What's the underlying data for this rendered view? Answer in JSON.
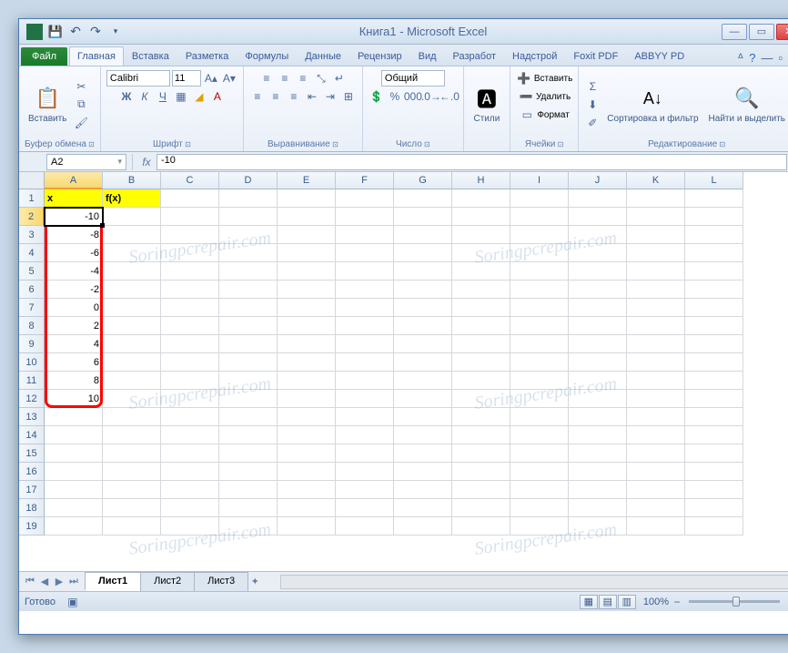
{
  "title": "Книга1  -  Microsoft Excel",
  "file_tab": "Файл",
  "tabs": [
    "Главная",
    "Вставка",
    "Разметка",
    "Формулы",
    "Данные",
    "Рецензир",
    "Вид",
    "Разработ",
    "Надстрой",
    "Foxit PDF",
    "ABBYY PD"
  ],
  "active_tab": 0,
  "ribbon": {
    "paste": "Вставить",
    "clipboard": "Буфер обмена",
    "font_name": "Calibri",
    "font_size": "11",
    "font": "Шрифт",
    "alignment": "Выравнивание",
    "number_format": "Общий",
    "number": "Число",
    "styles": "Стили",
    "insert": "Вставить",
    "delete": "Удалить",
    "format": "Формат",
    "cells": "Ячейки",
    "sort": "Сортировка и фильтр",
    "find": "Найти и выделить",
    "editing": "Редактирование"
  },
  "name_box": "A2",
  "formula": "-10",
  "columns": [
    "A",
    "B",
    "C",
    "D",
    "E",
    "F",
    "G",
    "H",
    "I",
    "J",
    "K",
    "L"
  ],
  "rows_visible": 19,
  "active_cell": {
    "row": 2,
    "col": 0
  },
  "grid": {
    "header": {
      "A": "x",
      "B": "f(x)"
    },
    "colA": [
      -10,
      -8,
      -6,
      -4,
      -2,
      0,
      2,
      4,
      6,
      8,
      10
    ]
  },
  "sheets": [
    "Лист1",
    "Лист2",
    "Лист3"
  ],
  "active_sheet": 0,
  "status": "Готово",
  "zoom": "100%",
  "watermark": "Soringpcrepair.com"
}
